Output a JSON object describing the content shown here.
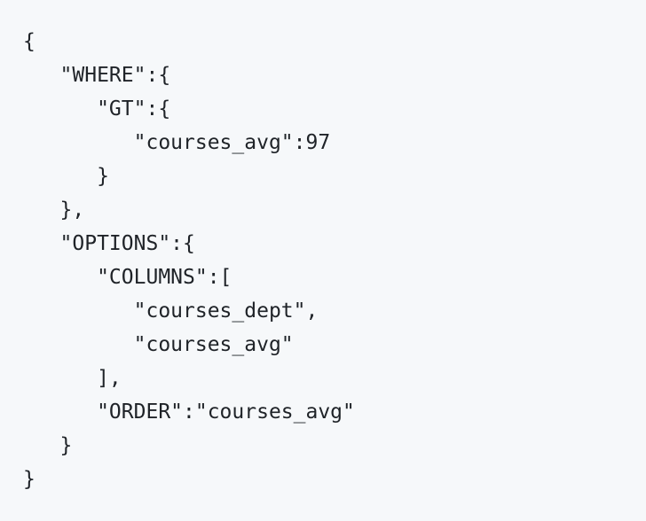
{
  "code": {
    "lines": [
      "{",
      "   \"WHERE\":{",
      "      \"GT\":{",
      "         \"courses_avg\":97",
      "      }",
      "   },",
      "   \"OPTIONS\":{",
      "      \"COLUMNS\":[",
      "         \"courses_dept\",",
      "         \"courses_avg\"",
      "      ],",
      "      \"ORDER\":\"courses_avg\"",
      "   }",
      "}"
    ]
  }
}
